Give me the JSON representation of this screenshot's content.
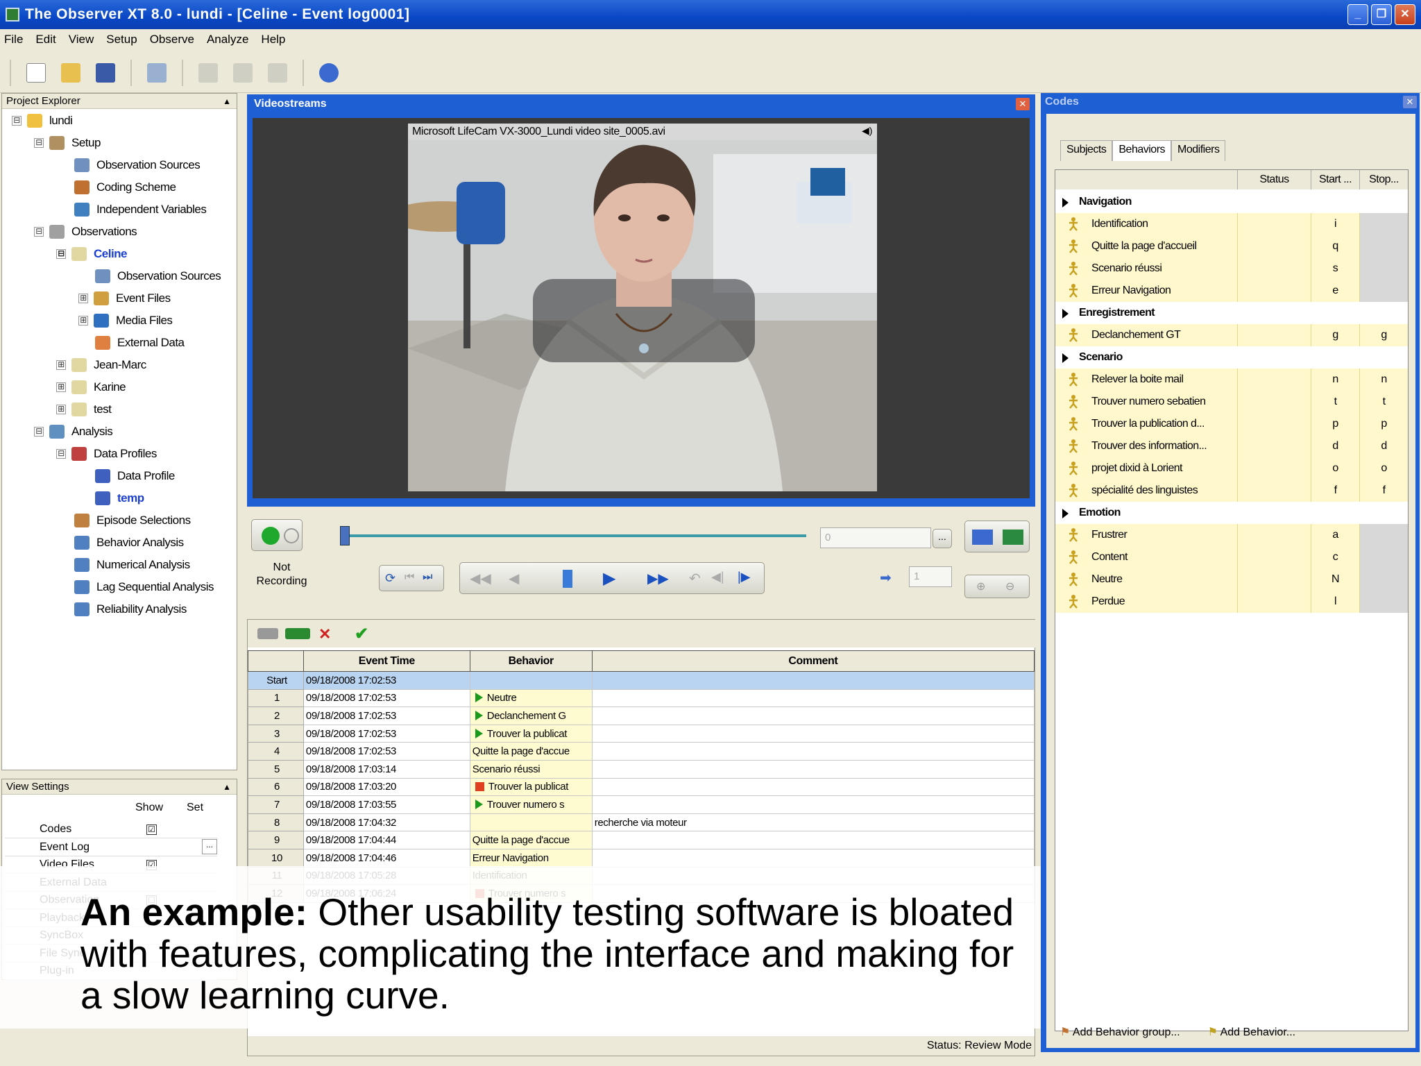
{
  "window": {
    "title": "The Observer XT 8.0 - lundi - [Celine - Event log0001]",
    "controls": [
      "_",
      "❐",
      "✕"
    ]
  },
  "menu": [
    "File",
    "Edit",
    "View",
    "Setup",
    "Observe",
    "Analyze",
    "Help"
  ],
  "toolbar_icons": [
    "new-icon",
    "open-icon",
    "save-icon",
    "properties-icon",
    "cut-icon",
    "copy-icon",
    "paste-icon",
    "help-icon"
  ],
  "project_explorer": {
    "header": "Project Explorer",
    "items": [
      {
        "label": "lundi",
        "exp": "⊟",
        "color": "#f0c040"
      },
      {
        "label": "Setup",
        "exp": "⊟",
        "color": "#b09060"
      },
      {
        "label": "Observation Sources",
        "exp": "",
        "color": "#7090c0"
      },
      {
        "label": "Coding Scheme",
        "exp": "",
        "color": "#c07030"
      },
      {
        "label": "Independent Variables",
        "exp": "",
        "color": "#4080c0"
      },
      {
        "label": "Observations",
        "exp": "⊟",
        "color": "#a0a0a0"
      },
      {
        "label": "Celine",
        "exp": "⊟",
        "color": "#e0d8a0",
        "bold": true
      },
      {
        "label": "Observation Sources",
        "exp": "",
        "color": "#7090c0"
      },
      {
        "label": "Event Files",
        "exp": "⊞",
        "color": "#d0a040"
      },
      {
        "label": "Media Files",
        "exp": "⊞",
        "color": "#3070c0"
      },
      {
        "label": "External Data",
        "exp": "",
        "color": "#e08040"
      },
      {
        "label": "Jean-Marc",
        "exp": "⊞",
        "color": "#e0d8a0"
      },
      {
        "label": "Karine",
        "exp": "⊞",
        "color": "#e0d8a0"
      },
      {
        "label": "test",
        "exp": "⊞",
        "color": "#e0d8a0"
      },
      {
        "label": "Analysis",
        "exp": "⊟",
        "color": "#6090c0"
      },
      {
        "label": "Data Profiles",
        "exp": "⊟",
        "color": "#c04040"
      },
      {
        "label": "Data Profile",
        "exp": "",
        "color": "#4060c0"
      },
      {
        "label": "temp",
        "exp": "",
        "color": "#4060c0",
        "bold": true
      },
      {
        "label": "Episode Selections",
        "exp": "",
        "color": "#c08040"
      },
      {
        "label": "Behavior Analysis",
        "exp": "",
        "color": "#5080c0"
      },
      {
        "label": "Numerical Analysis",
        "exp": "",
        "color": "#5080c0"
      },
      {
        "label": "Lag Sequential Analysis",
        "exp": "",
        "color": "#5080c0"
      },
      {
        "label": "Reliability Analysis",
        "exp": "",
        "color": "#5080c0"
      }
    ]
  },
  "view_settings": {
    "header": "View Settings",
    "col_show": "Show",
    "col_set": "Set",
    "rows": [
      {
        "label": "Codes",
        "checked": "☑",
        "set": ""
      },
      {
        "label": "Event Log",
        "checked": "",
        "set": "..."
      },
      {
        "label": "Video Files",
        "checked": "☑",
        "set": ""
      },
      {
        "label": "External Data",
        "checked": "",
        "set": ""
      },
      {
        "label": "Observation",
        "checked": "☐",
        "set": ""
      },
      {
        "label": "Playback",
        "checked": "",
        "set": ""
      },
      {
        "label": "SyncBox",
        "checked": "",
        "set": ""
      },
      {
        "label": "File Sync",
        "checked": "",
        "set": ""
      },
      {
        "label": "Plug-in",
        "checked": "",
        "set": ""
      }
    ]
  },
  "videostreams": {
    "title": "Videostreams",
    "caption": "Microsoft LifeCam VX-3000_Lundi video site_0005.avi"
  },
  "player": {
    "recording_label_1": "Not",
    "recording_label_2": "Recording",
    "time_value": "0",
    "step_value": "1"
  },
  "event_log": {
    "columns": [
      "",
      "Event Time",
      "Behavior",
      "Comment"
    ],
    "rows": [
      {
        "n": "Start",
        "time": "09/18/2008 17:02:53",
        "behavior": "",
        "marker": "",
        "comment": "",
        "selected": true
      },
      {
        "n": "1",
        "time": "09/18/2008 17:02:53",
        "behavior": "Neutre",
        "marker": "go",
        "comment": ""
      },
      {
        "n": "2",
        "time": "09/18/2008 17:02:53",
        "behavior": "Declanchement G",
        "marker": "go",
        "comment": ""
      },
      {
        "n": "3",
        "time": "09/18/2008 17:02:53",
        "behavior": "Trouver la publicat",
        "marker": "go",
        "comment": ""
      },
      {
        "n": "4",
        "time": "09/18/2008 17:02:53",
        "behavior": "Quitte la page d'accue",
        "marker": "",
        "comment": ""
      },
      {
        "n": "5",
        "time": "09/18/2008 17:03:14",
        "behavior": "Scenario réussi",
        "marker": "",
        "comment": ""
      },
      {
        "n": "6",
        "time": "09/18/2008 17:03:20",
        "behavior": "Trouver la publicat",
        "marker": "stop",
        "comment": ""
      },
      {
        "n": "7",
        "time": "09/18/2008 17:03:55",
        "behavior": "Trouver numero s",
        "marker": "go",
        "comment": ""
      },
      {
        "n": "8",
        "time": "09/18/2008 17:04:32",
        "behavior": "",
        "marker": "",
        "comment": "recherche via moteur"
      },
      {
        "n": "9",
        "time": "09/18/2008 17:04:44",
        "behavior": "Quitte la page d'accue",
        "marker": "",
        "comment": ""
      },
      {
        "n": "10",
        "time": "09/18/2008 17:04:46",
        "behavior": "Erreur Navigation",
        "marker": "",
        "comment": ""
      },
      {
        "n": "11",
        "time": "09/18/2008 17:05:28",
        "behavior": "Identification",
        "marker": "",
        "comment": ""
      },
      {
        "n": "12",
        "time": "09/18/2008 17:06:24",
        "behavior": "Trouver numero s",
        "marker": "stop",
        "comment": ""
      }
    ],
    "status": "Status: Review Mode"
  },
  "codes": {
    "title": "Codes",
    "tabs": [
      "Subjects",
      "Behaviors",
      "Modifiers"
    ],
    "columns": {
      "status": "Status",
      "start": "Start ...",
      "stop": "Stop..."
    },
    "rows": [
      {
        "type": "group",
        "label": "Navigation"
      },
      {
        "type": "behavior",
        "label": "Identification",
        "start": "i",
        "stop": "",
        "grey": true
      },
      {
        "type": "behavior",
        "label": "Quitte la page d'accueil",
        "start": "q",
        "stop": "",
        "grey": true
      },
      {
        "type": "behavior",
        "label": "Scenario réussi",
        "start": "s",
        "stop": "",
        "grey": true
      },
      {
        "type": "behavior",
        "label": "Erreur Navigation",
        "start": "e",
        "stop": "",
        "grey": true
      },
      {
        "type": "group",
        "label": "Enregistrement"
      },
      {
        "type": "behavior",
        "label": "Declanchement GT",
        "start": "g",
        "stop": "g",
        "grey": false
      },
      {
        "type": "group",
        "label": "Scenario"
      },
      {
        "type": "behavior",
        "label": "Relever la boite mail",
        "start": "n",
        "stop": "n",
        "grey": false
      },
      {
        "type": "behavior",
        "label": "Trouver numero sebatien",
        "start": "t",
        "stop": "t",
        "grey": false
      },
      {
        "type": "behavior",
        "label": "Trouver la publication d...",
        "start": "p",
        "stop": "p",
        "grey": false
      },
      {
        "type": "behavior",
        "label": "Trouver des information...",
        "start": "d",
        "stop": "d",
        "grey": false
      },
      {
        "type": "behavior",
        "label": "projet dixid à Lorient",
        "start": "o",
        "stop": "o",
        "grey": false
      },
      {
        "type": "behavior",
        "label": "spécialité des linguistes",
        "start": "f",
        "stop": "f",
        "grey": false
      },
      {
        "type": "group",
        "label": "Emotion"
      },
      {
        "type": "behavior",
        "label": "Frustrer",
        "start": "a",
        "stop": "",
        "grey": true
      },
      {
        "type": "behavior",
        "label": "Content",
        "start": "c",
        "stop": "",
        "grey": true
      },
      {
        "type": "behavior",
        "label": "Neutre",
        "start": "N",
        "stop": "",
        "grey": true
      },
      {
        "type": "behavior",
        "label": "Perdue",
        "start": "l",
        "stop": "",
        "grey": true
      }
    ],
    "add_group": "Add Behavior group...",
    "add_behavior": "Add Behavior..."
  },
  "caption": {
    "bold": "An example:",
    "text": " Other usability testing software is bloated with features, complicating the interface and making for a slow learning curve."
  }
}
